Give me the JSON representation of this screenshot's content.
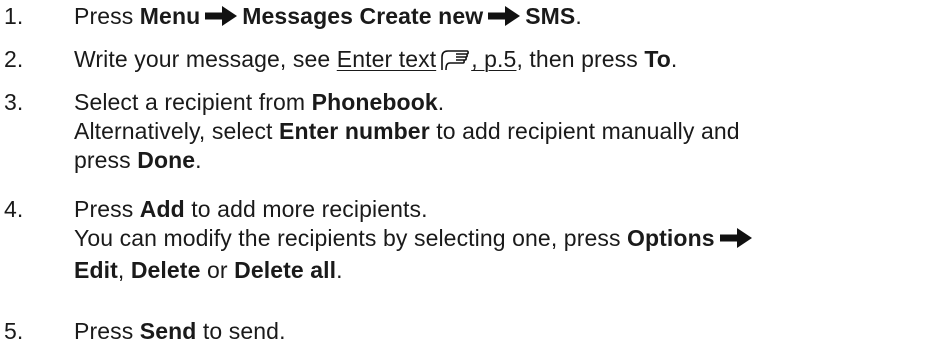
{
  "steps": [
    {
      "number": "1.",
      "lines": [
        {
          "t1": "Press ",
          "menu": "Menu",
          "messages_create_new": "Messages Create new",
          "sms": "SMS",
          "t2": "."
        }
      ]
    },
    {
      "number": "2.",
      "lines": [
        {
          "t1": "Write your message, see ",
          "link_text": "Enter text",
          "link_page": ", p.5",
          "t2": ", then press ",
          "to": "To",
          "t3": "."
        }
      ]
    },
    {
      "number": "3.",
      "lines": [
        {
          "t1": "Select a recipient from ",
          "phonebook": "Phonebook",
          "t2": "."
        },
        {
          "t1": "Alternatively, select ",
          "enter_number": "Enter number",
          "t2": " to add recipient manually and"
        },
        {
          "t1": "press ",
          "done": "Done",
          "t2": "."
        }
      ]
    },
    {
      "number": "4.",
      "lines": [
        {
          "t1": "Press ",
          "add": "Add",
          "t2": " to add more recipients."
        },
        {
          "t1": "You can modify the recipients by selecting one, press ",
          "options": "Options"
        },
        {
          "edit": "Edit",
          "t1": ", ",
          "delete": "Delete",
          "t2": " or ",
          "delete_all": "Delete all",
          "t3": "."
        }
      ]
    },
    {
      "number": "5.",
      "lines": [
        {
          "t1": "Press ",
          "send": "Send",
          "t2": " to send."
        }
      ]
    }
  ],
  "icons": {
    "arrow": "right-arrow-icon",
    "reference": "pointing-hand-icon"
  }
}
